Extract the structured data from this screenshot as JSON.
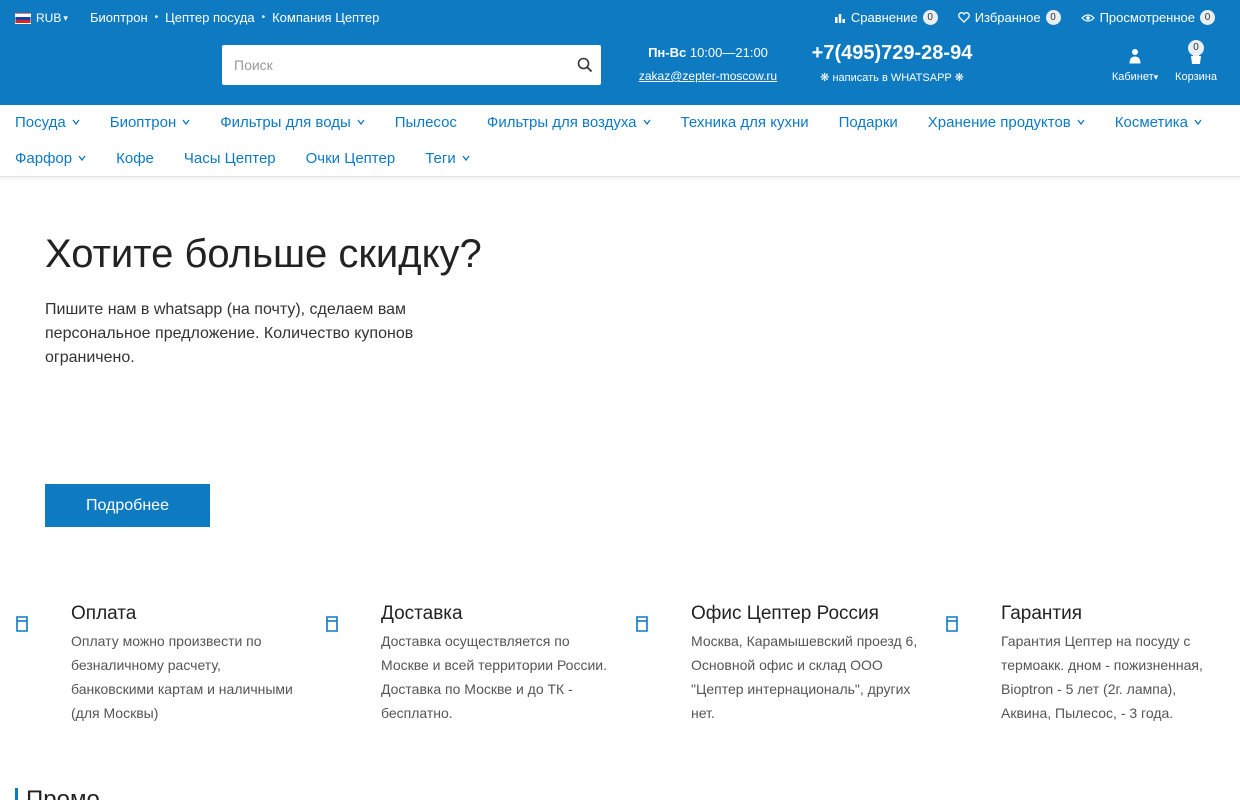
{
  "header": {
    "currency": "RUB",
    "top_links": [
      "Биоптрон",
      "Цептер посуда",
      "Компания Цептер"
    ],
    "tools": [
      {
        "label": "Сравнение",
        "count": "0",
        "icon": "compare-icon"
      },
      {
        "label": "Избранное",
        "count": "0",
        "icon": "heart-icon"
      },
      {
        "label": "Просмотренное",
        "count": "0",
        "icon": "eye-icon"
      }
    ],
    "search_placeholder": "Поиск",
    "work_days": "Пн-Вс",
    "work_hours": "10:00—21:00",
    "email": "zakaz@zepter-moscow.ru",
    "phone": "+7(495)729-28-94",
    "whatsapp": "❋ написать в WHATSAPP ❋",
    "account_label": "Кабинет",
    "cart_label": "Корзина",
    "cart_count": "0"
  },
  "nav": {
    "row1": [
      {
        "label": "Посуда",
        "dropdown": true
      },
      {
        "label": "Биоптрон",
        "dropdown": true
      },
      {
        "label": "Фильтры для воды",
        "dropdown": true
      },
      {
        "label": "Пылесос",
        "dropdown": false
      },
      {
        "label": "Фильтры для воздуха",
        "dropdown": true
      },
      {
        "label": "Техника для кухни",
        "dropdown": false
      },
      {
        "label": "Подарки",
        "dropdown": false
      },
      {
        "label": "Хранение продуктов",
        "dropdown": true
      },
      {
        "label": "Косметика",
        "dropdown": true
      }
    ],
    "row2": [
      {
        "label": "Фарфор",
        "dropdown": true
      },
      {
        "label": "Кофе",
        "dropdown": false
      },
      {
        "label": "Часы Цептер",
        "dropdown": false
      },
      {
        "label": "Очки Цептер",
        "dropdown": false
      },
      {
        "label": "Теги",
        "dropdown": true
      }
    ]
  },
  "promo": {
    "title": "Хотите больше скидку?",
    "text": "Пишите нам в whatsapp (на почту), сделаем вам персональное предложение. Количество купонов ограничено.",
    "button": "Подробнее"
  },
  "features": [
    {
      "title": "Оплата",
      "text": "Оплату можно произвести по безналичному расчету, банковскими картам и наличными (для Москвы)",
      "icon": "wallet-icon"
    },
    {
      "title": "Доставка",
      "text": "Доставка осуществляется по Москве и всей территории России. Доставка по Москве и до ТК - бесплатно.",
      "icon": "truck-icon"
    },
    {
      "title": "Офис Цептер Россия",
      "text": "Москва, Карамышевский проезд 6, Основной офис и склад ООО \"Цептер интернациональ\", других нет.",
      "icon": "office-icon"
    },
    {
      "title": "Гарантия",
      "text": "Гарантия Цептер на посуду с термоакк. дном - пожизненная, Bioptron - 5 лет (2г. лампа), Аквина, Пылесос, - 3 года.",
      "icon": "shield-icon"
    }
  ],
  "section_title": "Промо",
  "colors": {
    "brand": "#0d7ac2"
  }
}
